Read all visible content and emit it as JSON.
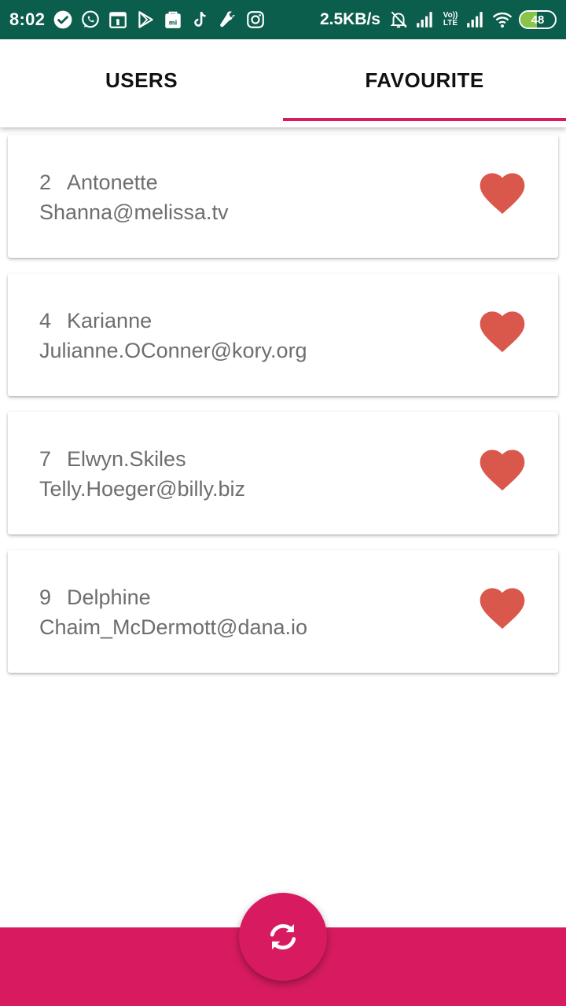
{
  "status_bar": {
    "time": "8:02",
    "net_speed": "2.5KB/s",
    "volte_top": "Vo))",
    "volte_bottom": "LTE",
    "battery": "48",
    "battery_fraction": 0.48,
    "background_color": "#0b5d4c",
    "icons": [
      "check-circle-icon",
      "whatsapp-icon",
      "calendar-icon",
      "play-store-icon",
      "mi-store-icon",
      "tiktok-icon",
      "wrench-icon",
      "instagram-icon",
      "mute-bell-icon",
      "signal-icon",
      "signal-icon",
      "wifi-icon",
      "battery-icon"
    ]
  },
  "tabs": [
    {
      "label": "USERS",
      "selected": false
    },
    {
      "label": "FAVOURITE",
      "selected": true
    }
  ],
  "users": [
    {
      "id": "2",
      "name": "Antonette",
      "email": "Shanna@melissa.tv",
      "favourite": true
    },
    {
      "id": "4",
      "name": "Karianne",
      "email": "Julianne.OConner@kory.org",
      "favourite": true
    },
    {
      "id": "7",
      "name": "Elwyn.Skiles",
      "email": "Telly.Hoeger@billy.biz",
      "favourite": true
    },
    {
      "id": "9",
      "name": "Delphine",
      "email": "Chaim_McDermott@dana.io",
      "favourite": true
    }
  ],
  "fab": {
    "icon": "refresh-icon"
  },
  "colors": {
    "accent": "#d81b60",
    "heart": "#d9584b",
    "text_secondary": "#6e6e6e"
  }
}
